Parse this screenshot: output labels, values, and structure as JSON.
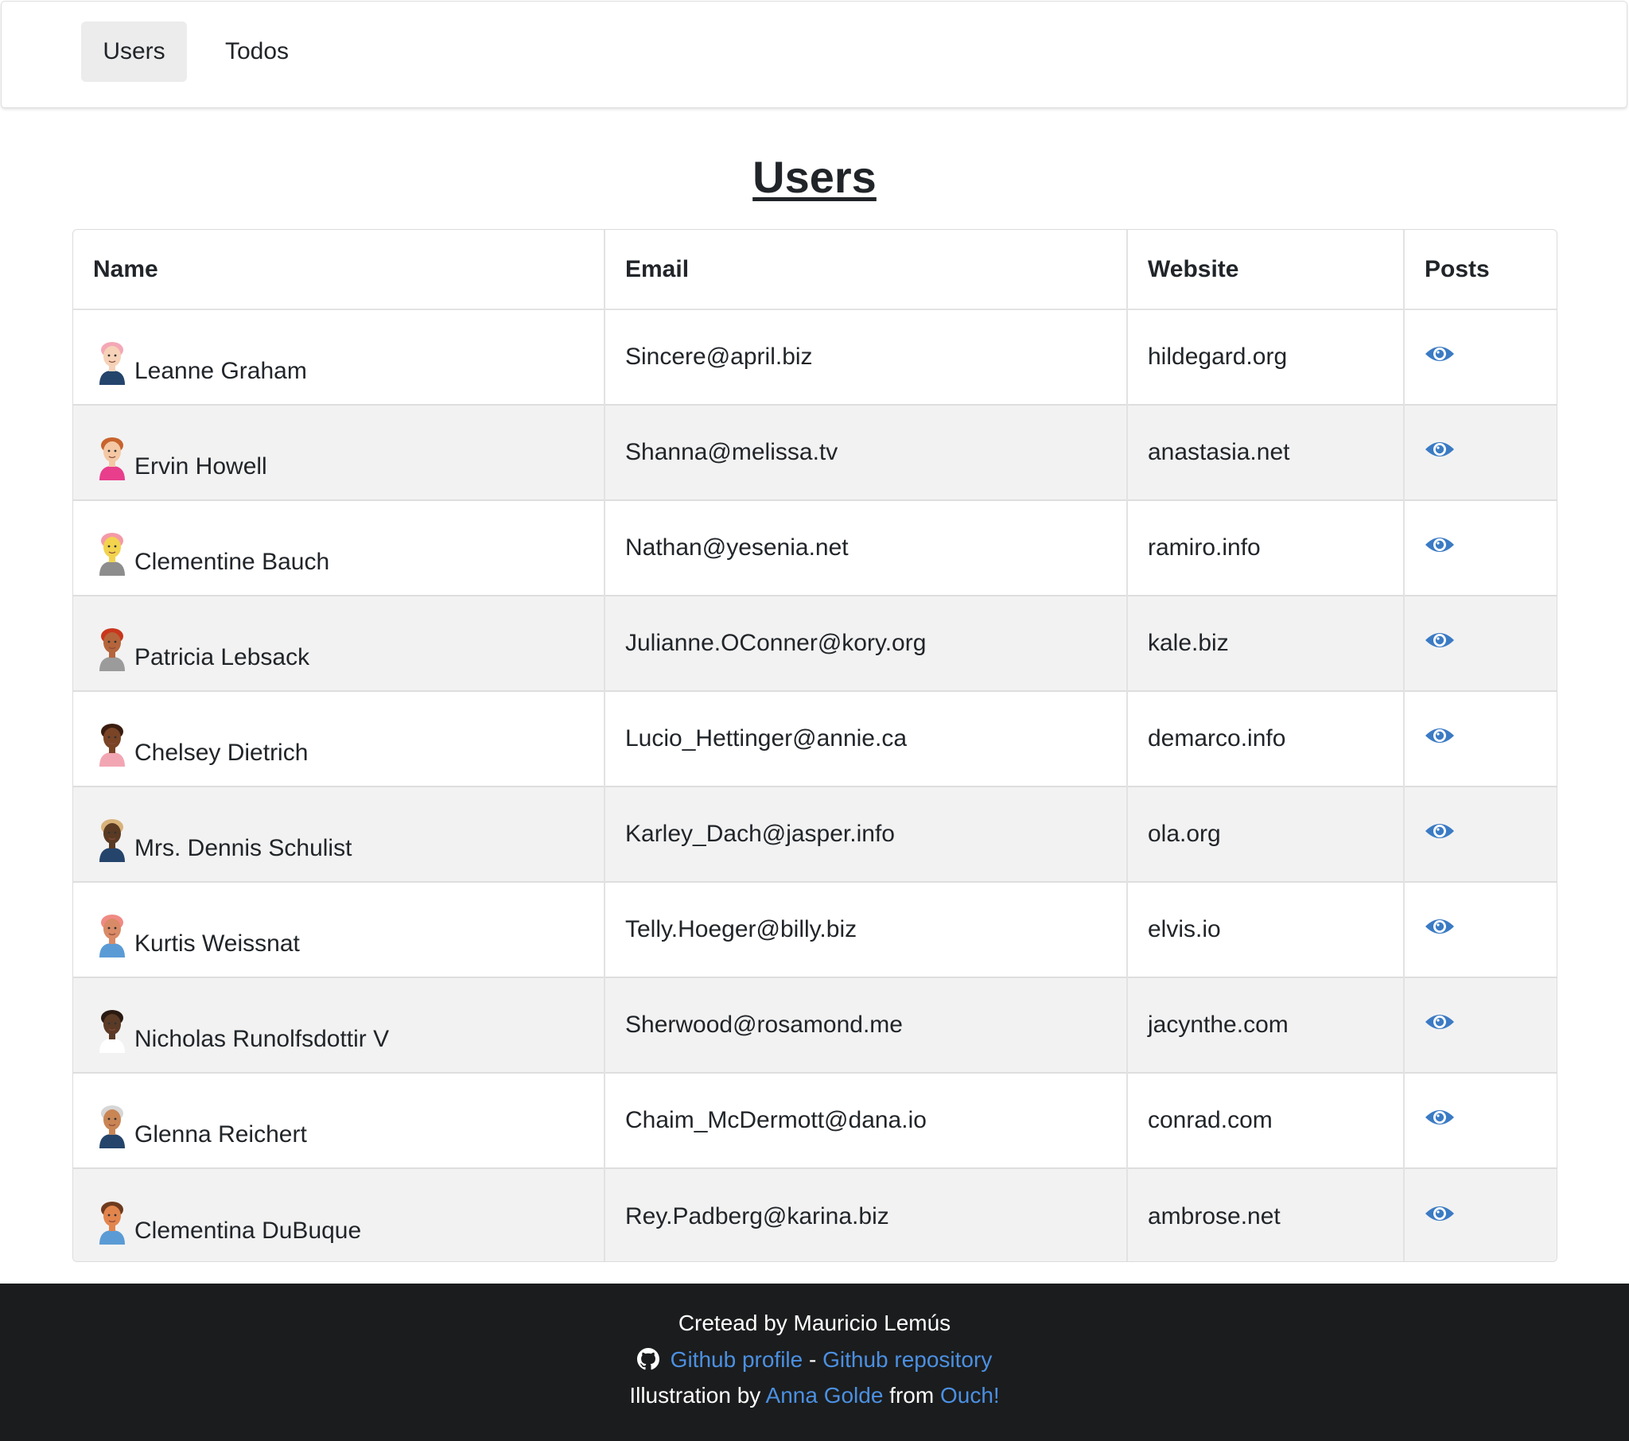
{
  "nav": {
    "items": [
      {
        "label": "Users",
        "active": true
      },
      {
        "label": "Todos",
        "active": false
      }
    ]
  },
  "page": {
    "title": "Users"
  },
  "table": {
    "headers": [
      "Name",
      "Email",
      "Website",
      "Posts"
    ],
    "posts_icon": "eye-icon",
    "rows": [
      {
        "name": "Leanne Graham",
        "email": "Sincere@april.biz",
        "website": "hildegard.org",
        "avatar": {
          "skin": "#f6d2b8",
          "hair": "#f4a8b6",
          "shirt": "#24446b"
        }
      },
      {
        "name": "Ervin Howell",
        "email": "Shanna@melissa.tv",
        "website": "anastasia.net",
        "avatar": {
          "skin": "#f4c8a4",
          "hair": "#c8632d",
          "shirt": "#e83e8c"
        }
      },
      {
        "name": "Clementine Bauch",
        "email": "Nathan@yesenia.net",
        "website": "ramiro.info",
        "avatar": {
          "skin": "#f2d34e",
          "hair": "#f49aa7",
          "shirt": "#8d8d8d"
        }
      },
      {
        "name": "Patricia Lebsack",
        "email": "Julianne.OConner@kory.org",
        "website": "kale.biz",
        "avatar": {
          "skin": "#b5653b",
          "hair": "#c9361d",
          "shirt": "#9b9b9b"
        }
      },
      {
        "name": "Chelsey Dietrich",
        "email": "Lucio_Hettinger@annie.ca",
        "website": "demarco.info",
        "avatar": {
          "skin": "#7a4426",
          "hair": "#3a1d10",
          "shirt": "#f2a6b3"
        }
      },
      {
        "name": "Mrs. Dennis Schulist",
        "email": "Karley_Dach@jasper.info",
        "website": "ola.org",
        "avatar": {
          "skin": "#5a3a22",
          "hair": "#d9b27a",
          "shirt": "#24446b"
        }
      },
      {
        "name": "Kurtis Weissnat",
        "email": "Telly.Hoeger@billy.biz",
        "website": "elvis.io",
        "avatar": {
          "skin": "#d98a66",
          "hair": "#f08a84",
          "shirt": "#5b9bd5"
        }
      },
      {
        "name": "Nicholas Runolfsdottir V",
        "email": "Sherwood@rosamond.me",
        "website": "jacynthe.com",
        "avatar": {
          "skin": "#5b3a26",
          "hair": "#2a1a12",
          "shirt": "#ffffff"
        }
      },
      {
        "name": "Glenna Reichert",
        "email": "Chaim_McDermott@dana.io",
        "website": "conrad.com",
        "avatar": {
          "skin": "#c98554",
          "hair": "#d6d6d6",
          "shirt": "#24446b"
        }
      },
      {
        "name": "Clementina DuBuque",
        "email": "Rey.Padberg@karina.biz",
        "website": "ambrose.net",
        "avatar": {
          "skin": "#e2854d",
          "hair": "#6e3a1e",
          "shirt": "#5b9bd5"
        }
      }
    ]
  },
  "footer": {
    "created_by": "Cretead by Mauricio Lemús",
    "github_icon": "github-icon",
    "github_profile": "Github profile",
    "separator": " - ",
    "github_repo": "Github repository",
    "illustration_prefix": "Illustration by ",
    "illustrator": "Anna Golde",
    "from_text": " from ",
    "source": "Ouch!"
  },
  "colors": {
    "accent": "#3b7bc4",
    "link": "#4b90e2",
    "footer_bg": "#1b1c1d",
    "stripe": "#f2f2f2",
    "nav_active": "#ececec"
  }
}
